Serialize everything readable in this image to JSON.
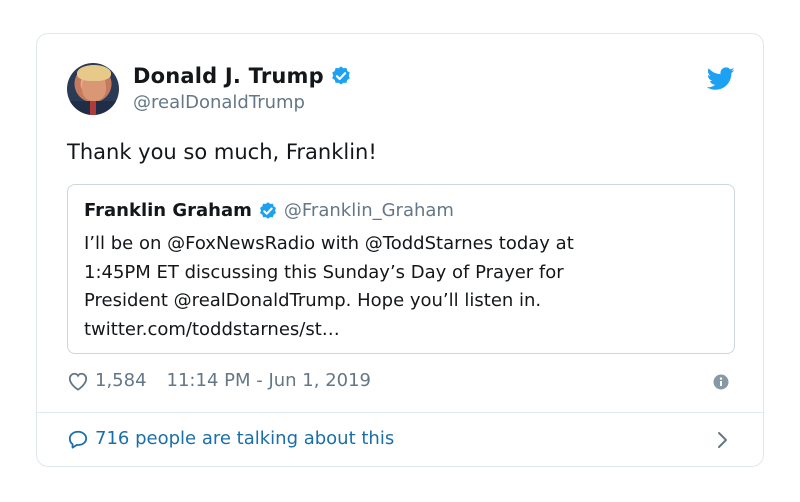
{
  "author": {
    "display_name": "Donald J. Trump",
    "handle": "@realDonaldTrump"
  },
  "tweet": {
    "text": "Thank you so much, Franklin!"
  },
  "quoted_tweet": {
    "display_name": "Franklin Graham",
    "handle": "@Franklin_Graham",
    "lines": [
      "I’ll be on @FoxNewsRadio with @ToddStarnes today at",
      "1:45PM ET discussing this Sunday’s Day of Prayer for",
      "President @realDonaldTrump. Hope you’ll listen in.",
      "twitter.com/toddstarnes/st…"
    ]
  },
  "stats": {
    "likes": "1,584",
    "timestamp": "11:14 PM - Jun 1, 2019"
  },
  "footer": {
    "conversation": "716 people are talking about this"
  },
  "icons": {
    "verified": "verified-badge-icon",
    "twitter": "twitter-bird-icon",
    "like": "heart-icon",
    "info": "info-icon",
    "reply": "speech-bubble-icon",
    "chevron": "chevron-right-icon"
  },
  "colors": {
    "accent_blue": "#1da1f2",
    "link_blue": "#1b6fa8",
    "secondary_text": "#657786",
    "border": "#e1e8ed"
  }
}
